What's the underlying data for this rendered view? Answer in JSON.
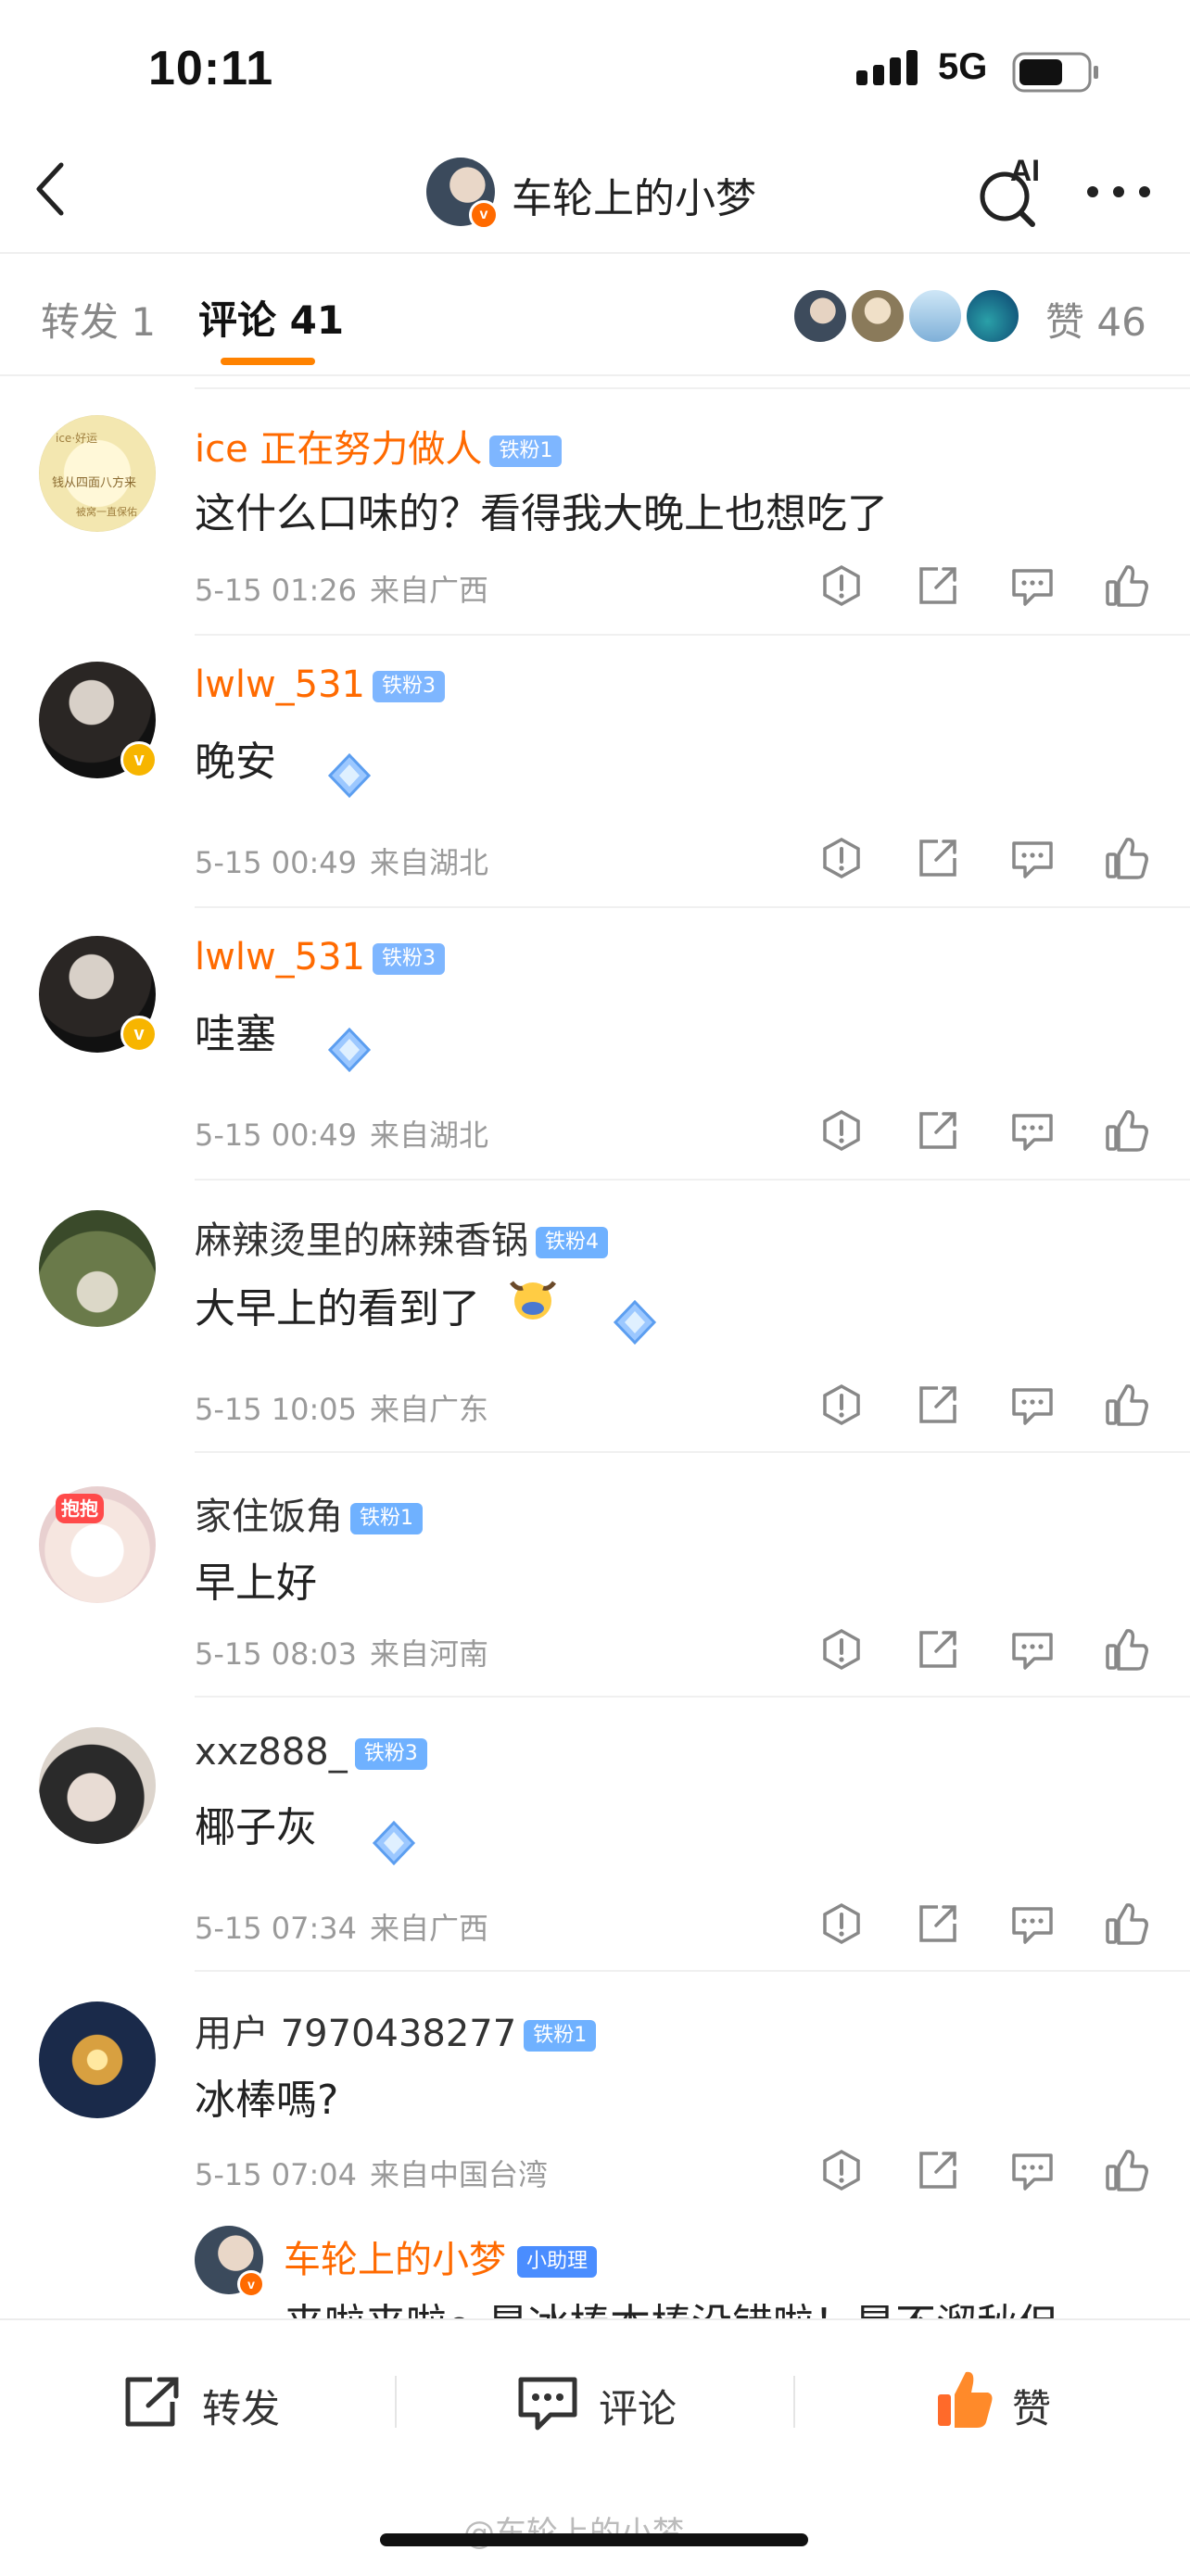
{
  "status": {
    "time": "10:11",
    "network": "5G"
  },
  "nav": {
    "title": "车轮上的小梦",
    "ai_label": "AI"
  },
  "tabs": {
    "repost": "转发 1",
    "comment": "评论 41",
    "likes": "赞 46"
  },
  "colors": {
    "accent": "#ff8200",
    "username_highlight": "#ff6a00",
    "fan_badge": "#6fb1ff",
    "verified": "#f7b500"
  },
  "comments": [
    {
      "user": "ice 正在努力做人",
      "badge": "铁粉1",
      "text": "这什么口味的？看得我大晚上也想吃了",
      "date": "5-15 01:26",
      "loc": "来自广西"
    },
    {
      "user": "lwlw_531",
      "badge": "铁粉3",
      "text": "晚安",
      "date": "5-15 00:49",
      "loc": "来自湖北"
    },
    {
      "user": "lwlw_531",
      "badge": "铁粉3",
      "text": "哇塞",
      "date": "5-15 00:49",
      "loc": "来自湖北"
    },
    {
      "user": "麻辣烫里的麻辣香锅",
      "badge": "铁粉4",
      "text": "大早上的看到了",
      "date": "5-15 10:05",
      "loc": "来自广东"
    },
    {
      "user": "家住饭角",
      "badge": "铁粉1",
      "text": "早上好",
      "date": "5-15 08:03",
      "loc": "来自河南"
    },
    {
      "user": "xxz888_",
      "badge": "铁粉3",
      "text": "椰子灰",
      "date": "5-15 07:34",
      "loc": "来自广西"
    },
    {
      "user": "用户 7970438277",
      "badge": "铁粉1",
      "text": "冰棒嗎?",
      "date": "5-15 07:04",
      "loc": "来自中国台湾"
    }
  ],
  "reply": {
    "user": "车轮上的小梦",
    "badge": "小助理",
    "text": "来啦来啦～是冰棒本棒没错啦！是不溜秋但"
  },
  "avatar_texts": {
    "first": [
      "ice·好运",
      "钱从四面八方来",
      "被窝一直保佑"
    ],
    "fourth": "抱抱"
  },
  "bottom_bar": {
    "repost": "转发",
    "comment": "评论",
    "like": "赞"
  },
  "watermark": "@车轮上的小梦",
  "icons": [
    "back-arrow-icon",
    "ai-search-icon",
    "more-icon",
    "report-icon",
    "share-icon",
    "reply-icon",
    "like-icon",
    "diamond-sticker-icon",
    "bull-emoji-icon",
    "verified-icon"
  ]
}
